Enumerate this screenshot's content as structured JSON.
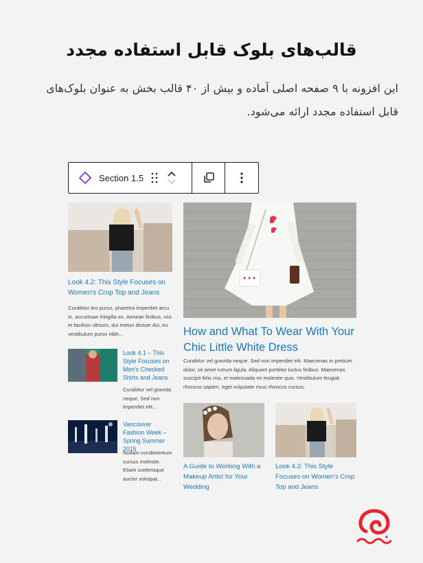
{
  "heading": "قالب‌های بلوک قابل استفاده مجدد",
  "description": "این افزونه با ۹ صفحه اصلی آماده و بیش از ۴۰ قالب بخش به عنوان بلوک‌های قابل استفاده مجدد ارائه می‌شود.",
  "toolbar": {
    "block_label": "Section 1.5",
    "block_icon": "section-block-icon",
    "drag_icon": "drag-handle-icon",
    "move_up_icon": "chevron-up-icon",
    "move_down_icon": "chevron-down-icon",
    "duplicate_icon": "duplicate-icon",
    "options_icon": "more-vertical-icon"
  },
  "posts": {
    "left_top": {
      "title": "Look 4.2: This Style Focuses on Women's Crop Top and Jeans",
      "excerpt": "Curabitur leo purus, pharetra imperdiet arcu in, accumsan fringilla ex. Aenean finibus, nisi et facilisis ultrices, dui metus dictum dui, eu vestibulum purus nibh..."
    },
    "left_mid": {
      "title": "Look 4.1 – This Style Focuses on Men's Checked Shirts and Jeans",
      "excerpt": "Curabitur vel gravida neque. Sed non imperdiet elit..."
    },
    "left_bottom": {
      "title": "Vancouver Fashion Week – Spring Summer 2015",
      "excerpt": "Nullam condimentum cursus molestie. Etiam scelerisque auctor volutpat..."
    },
    "featured": {
      "title": "How and What To Wear With Your Chic Little White Dress",
      "excerpt": "Curabitur vel gravida neque. Sed non imperdiet elit. Maecenas in pretium dolor, sit amet rutrum ligula. Aliquam porttitor luctus finibus. Maecenas suscipit felis nisi, et malesuada mi molestie quis. Vestibulum feugiat rhoncus sapien, eget vulputate risus rhoncus cursus."
    },
    "bottom_a": {
      "title": "A Guide to Working With a Makeup Artist for Your Wedding"
    },
    "bottom_b": {
      "title": "Look 4.2: This Style Focuses on Women's Crop Top and Jeans"
    }
  },
  "brand": {
    "logo_icon": "brand-logo-icon",
    "accent_color": "#e3262f"
  },
  "colors": {
    "link": "#1b75bb",
    "block_icon": "#7a3ff2"
  }
}
